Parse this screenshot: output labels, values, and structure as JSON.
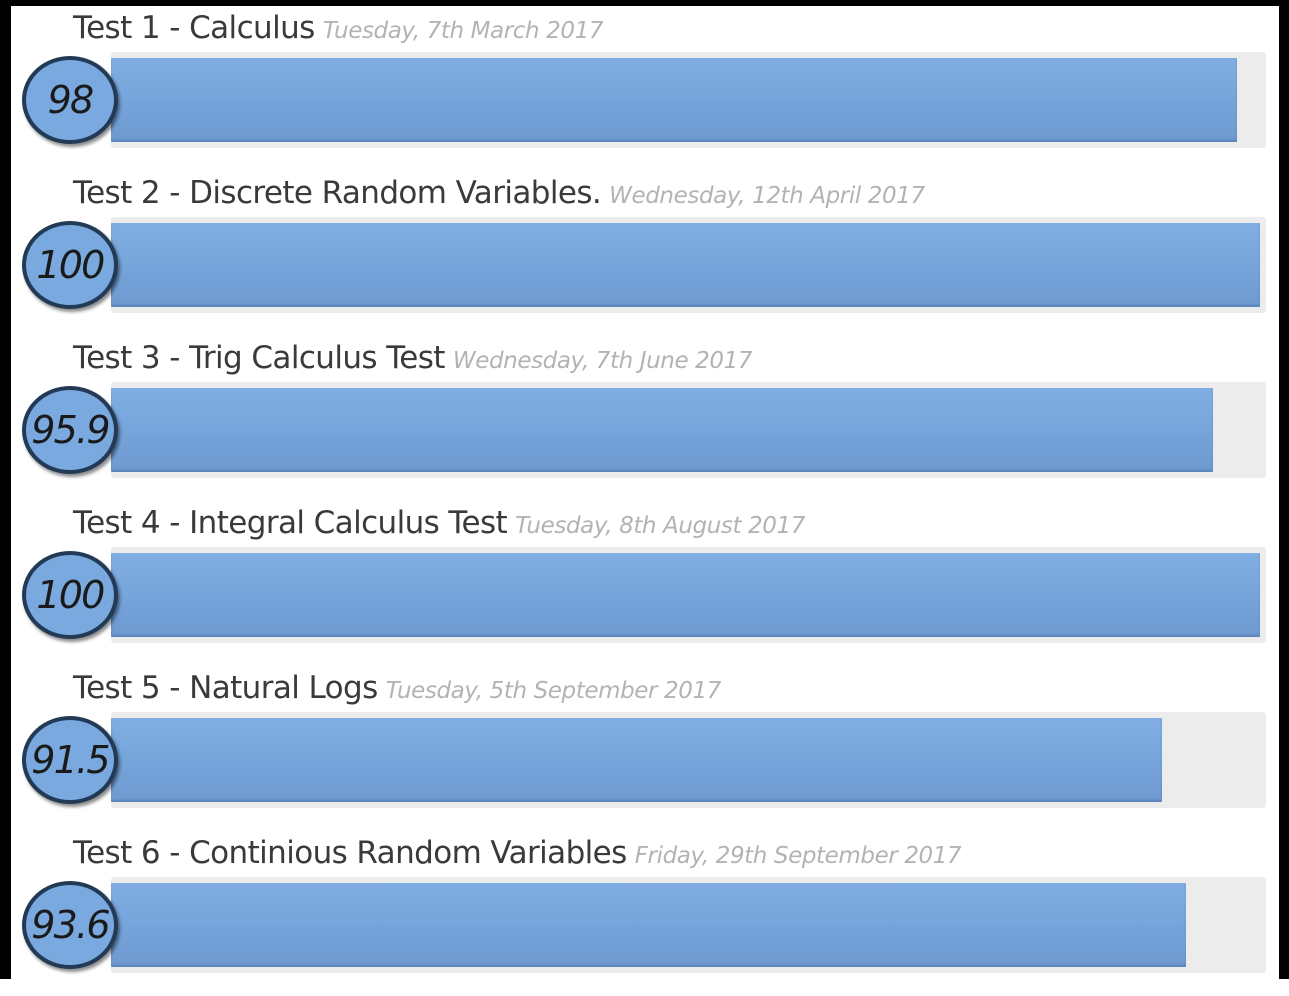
{
  "colors": {
    "bar_fill": "#77a6dc",
    "bar_track": "#ececec",
    "badge_border": "#223a56",
    "title_text": "#3a3a3a",
    "date_text": "#b3b3b3"
  },
  "tests": [
    {
      "title": "Test 1 - Calculus",
      "date": "Tuesday, 7th March 2017",
      "score": "98",
      "progress_percent": 98
    },
    {
      "title": "Test 2 - Discrete Random Variables.",
      "date": "Wednesday, 12th April 2017",
      "score": "100",
      "progress_percent": 100
    },
    {
      "title": "Test 3 - Trig Calculus Test",
      "date": "Wednesday, 7th June 2017",
      "score": "95.9",
      "progress_percent": 95.9
    },
    {
      "title": "Test 4 - Integral Calculus Test",
      "date": "Tuesday, 8th August 2017",
      "score": "100",
      "progress_percent": 100
    },
    {
      "title": "Test 5 - Natural Logs",
      "date": "Tuesday, 5th September 2017",
      "score": "91.5",
      "progress_percent": 91.5
    },
    {
      "title": "Test 6 - Continious Random Variables",
      "date": "Friday, 29th September 2017",
      "score": "93.6",
      "progress_percent": 93.6
    }
  ]
}
